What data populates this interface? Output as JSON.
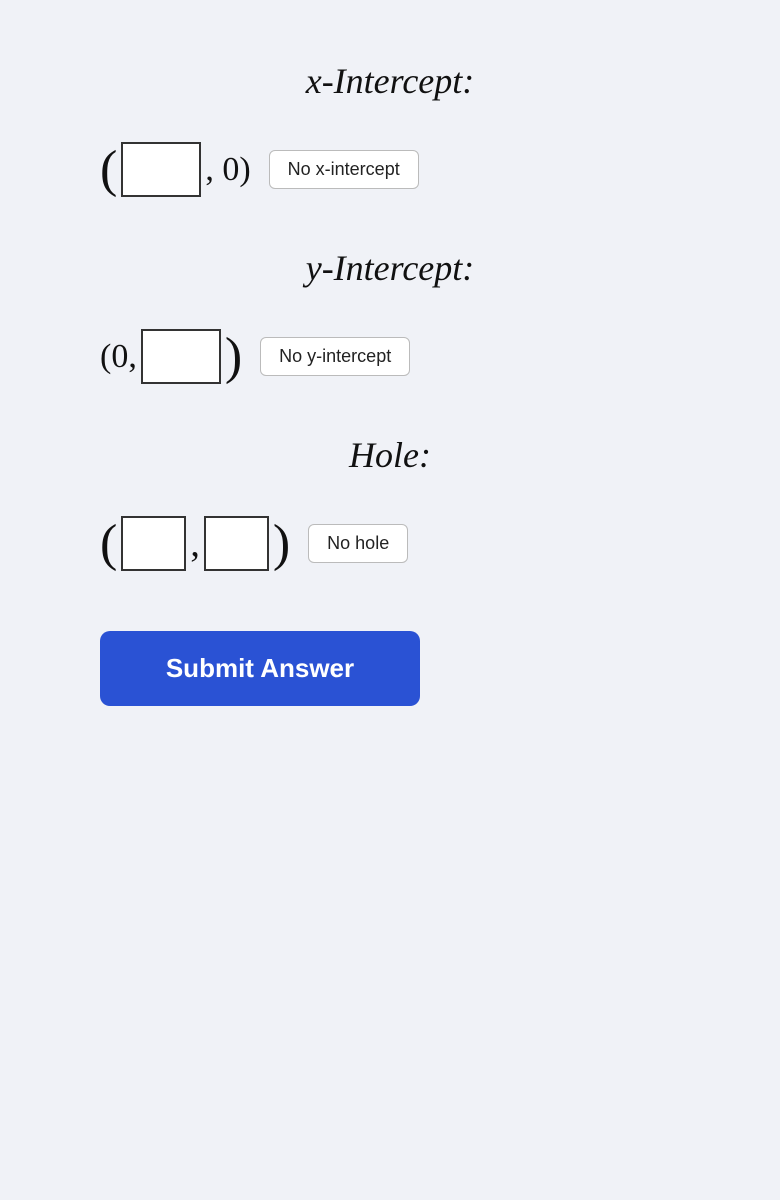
{
  "xIntercept": {
    "title": "x-Intercept:",
    "prefixParen": "(",
    "suffixText": ", 0)",
    "inputPlaceholder": "",
    "noButtonLabel": "No x-intercept"
  },
  "yIntercept": {
    "title": "y-Intercept:",
    "prefixText": "(0,",
    "suffixParen": ")",
    "inputPlaceholder": "",
    "noButtonLabel": "No y-intercept"
  },
  "hole": {
    "title": "Hole:",
    "prefixParen": "(",
    "comma": ",",
    "suffixParen": ")",
    "input1Placeholder": "",
    "input2Placeholder": "",
    "noButtonLabel": "No hole"
  },
  "submitButton": {
    "label": "Submit Answer"
  }
}
